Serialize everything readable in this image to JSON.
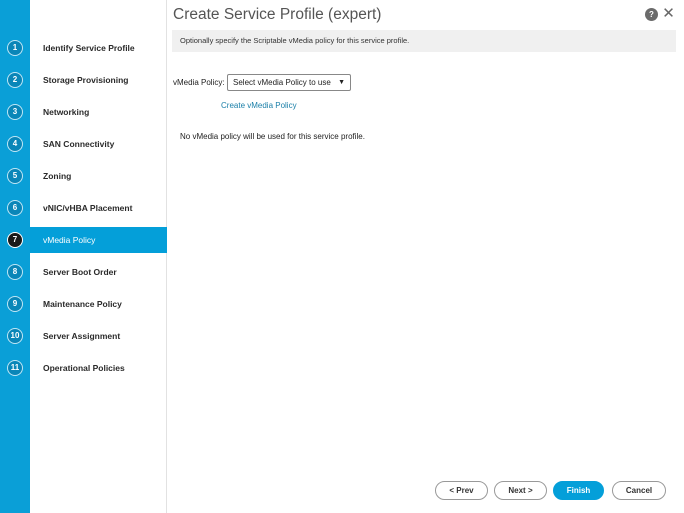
{
  "window": {
    "title": "Create Service Profile (expert)",
    "help_label": "?",
    "close_label": "✕"
  },
  "steps": [
    {
      "num": "1",
      "label": "Identify Service Profile"
    },
    {
      "num": "2",
      "label": "Storage Provisioning"
    },
    {
      "num": "3",
      "label": "Networking"
    },
    {
      "num": "4",
      "label": "SAN Connectivity"
    },
    {
      "num": "5",
      "label": "Zoning"
    },
    {
      "num": "6",
      "label": "vNIC/vHBA Placement"
    },
    {
      "num": "7",
      "label": "vMedia Policy"
    },
    {
      "num": "8",
      "label": "Server Boot Order"
    },
    {
      "num": "9",
      "label": "Maintenance Policy"
    },
    {
      "num": "10",
      "label": "Server Assignment"
    },
    {
      "num": "11",
      "label": "Operational Policies"
    }
  ],
  "active_step": "7",
  "main": {
    "description": "Optionally specify the Scriptable vMedia policy for this service profile.",
    "field_label": "vMedia Policy:",
    "select_value": "Select vMedia Policy to use",
    "create_link": "Create vMedia Policy",
    "notice": "No vMedia policy will be used for this service profile."
  },
  "buttons": {
    "prev": "< Prev",
    "next": "Next >",
    "finish": "Finish",
    "cancel": "Cancel"
  },
  "colors": {
    "accent": "#049fd9",
    "stripe": "#0a9fd7",
    "link": "#1a7fa8"
  }
}
